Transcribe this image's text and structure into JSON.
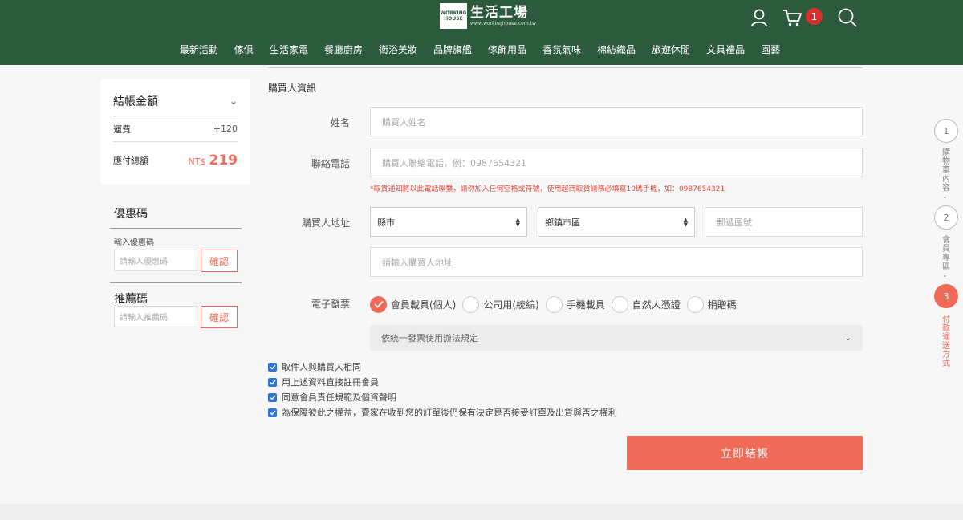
{
  "header": {
    "logo_line1": "WORKING",
    "logo_line2": "HOUSE",
    "logo_name": "生活工場",
    "logo_url": "www.workinghouse.com.tw",
    "cart_count": "1",
    "nav": [
      "最新活動",
      "傢俱",
      "生活家電",
      "餐廳廚房",
      "衛浴美妝",
      "品牌旗艦",
      "傢飾用品",
      "香氛氣味",
      "棉紡織品",
      "旅遊休閒",
      "文具禮品",
      "園藝"
    ]
  },
  "summary": {
    "title": "結帳金額",
    "shipping_label": "運費",
    "shipping_value": "+120",
    "total_label": "應付總額",
    "currency": "NT$",
    "total_value": "219"
  },
  "coupon": {
    "title": "優惠碼",
    "input_label": "輸入優惠碼",
    "placeholder": "請輸入優惠碼",
    "button": "確認"
  },
  "referral": {
    "title": "推薦碼",
    "placeholder": "請輸入推薦碼",
    "button": "確認"
  },
  "form": {
    "section_title": "購買人資訊",
    "name_label": "姓名",
    "name_placeholder": "購買人姓名",
    "phone_label": "聯絡電話",
    "phone_placeholder": "購買人聯絡電話，例：0987654321",
    "phone_hint": "*取貨通知將以此電話聯繫，請勿加入任何空格或符號，使用超商取貨請務必填寫10碼手機，如：0987654321",
    "address_label": "購買人地址",
    "city_value": "縣市",
    "district_value": "鄉鎮市區",
    "zip_placeholder": "郵遞區號",
    "address_placeholder": "請輸入購買人地址",
    "invoice_label": "電子發票",
    "invoice_options": [
      "會員載具(個人)",
      "公司用(統編)",
      "手機載具",
      "自然人憑證",
      "捐贈碼"
    ],
    "invoice_select": "依統一發票使用辦法規定"
  },
  "checkboxes": [
    "取件人與購買人相同",
    "用上述資料直接註冊會員",
    "同意會員責任規範及個資聲明",
    "為保障彼此之權益，賣家在收到您的訂單後仍保有決定是否接受訂單及出貨與否之權利"
  ],
  "submit_label": "立即結帳",
  "steps": [
    {
      "num": "1",
      "label": "購物車內容"
    },
    {
      "num": "2",
      "label": "會員專區"
    },
    {
      "num": "3",
      "label": "付款運送方式"
    }
  ],
  "colors": {
    "header_bg": "#2c5a3c",
    "accent": "#ef6b57",
    "badge": "#d6302f",
    "checkbox": "#2f73d8"
  }
}
